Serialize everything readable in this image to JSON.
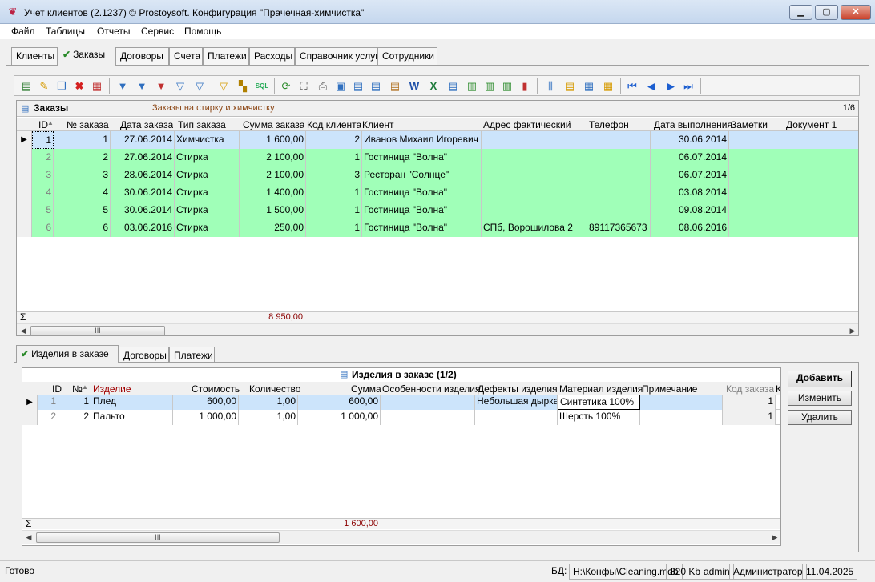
{
  "window": {
    "title": "Учет клиентов (2.1237) © Prostoysoft. Конфигурация \"Прачечная-химчистка\""
  },
  "menu": [
    "Файл",
    "Таблицы",
    "Отчеты",
    "Сервис",
    "Помощь"
  ],
  "main_tabs": [
    "Клиенты",
    "Заказы",
    "Договоры",
    "Счета",
    "Платежи",
    "Расходы",
    "Справочник услуг",
    "Сотрудники"
  ],
  "toolbar_icons": [
    "add-icon",
    "edit-icon",
    "copy-icon",
    "delete-icon",
    "delete-all-icon",
    "filter-icon",
    "filter-add-icon",
    "filter-remove-icon",
    "filter-clear-icon",
    "filter-settings-icon",
    "filter-saved-icon",
    "filter-tree-icon",
    "sql-icon",
    "refresh-icon",
    "find-icon",
    "print-icon",
    "preview-icon",
    "export-icon",
    "export2-icon",
    "export3-icon",
    "word-icon",
    "excel-icon",
    "export-xml-icon",
    "csv-icon",
    "csv2-icon",
    "csv3-icon",
    "chart-icon",
    "columns-icon",
    "fields-icon",
    "grid-icon",
    "grid2-icon",
    "first-icon",
    "prev-icon",
    "next-icon",
    "last-icon"
  ],
  "orders": {
    "title": "Заказы",
    "subtitle": "Заказы на стирку и химчистку",
    "counter": "1/6",
    "columns": [
      "ID",
      "№ заказа",
      "Дата заказа",
      "Тип заказа",
      "Сумма заказа",
      "Код клиента",
      "Клиент",
      "Адрес фактический",
      "Телефон",
      "Дата выполнения",
      "Заметки",
      "Документ 1"
    ],
    "rows": [
      [
        "1",
        "1",
        "27.06.2014",
        "Химчистка",
        "1 600,00",
        "2",
        "Иванов Михаил Игоревич",
        "",
        "",
        "30.06.2014",
        "",
        ""
      ],
      [
        "2",
        "2",
        "27.06.2014",
        "Стирка",
        "2 100,00",
        "1",
        "Гостиница \"Волна\"",
        "",
        "",
        "06.07.2014",
        "",
        ""
      ],
      [
        "3",
        "3",
        "28.06.2014",
        "Стирка",
        "2 100,00",
        "3",
        "Ресторан \"Солнце\"",
        "",
        "",
        "06.07.2014",
        "",
        ""
      ],
      [
        "4",
        "4",
        "30.06.2014",
        "Стирка",
        "1 400,00",
        "1",
        "Гостиница \"Волна\"",
        "",
        "",
        "03.08.2014",
        "",
        ""
      ],
      [
        "5",
        "5",
        "30.06.2014",
        "Стирка",
        "1 500,00",
        "1",
        "Гостиница \"Волна\"",
        "",
        "",
        "09.08.2014",
        "",
        ""
      ],
      [
        "6",
        "6",
        "03.06.2016",
        "Стирка",
        "250,00",
        "1",
        "Гостиница \"Волна\"",
        "СПб, Ворошилова 2",
        "89117365673",
        "08.06.2016",
        "",
        ""
      ]
    ],
    "sum_symbol": "Σ",
    "total": "8 950,00",
    "scroll_thumb": "III"
  },
  "sub_tabs": [
    "Изделия в заказе",
    "Договоры",
    "Платежи"
  ],
  "items": {
    "title": "Изделия в заказе (1/2)",
    "columns": [
      "ID",
      "№",
      "Изделие",
      "Стоимость",
      "Количество",
      "Сумма",
      "Особенности изделия",
      "Дефекты изделия",
      "Материал изделия",
      "Примечание",
      "Код заказа",
      "К"
    ],
    "rows": [
      [
        "1",
        "1",
        "Плед",
        "600,00",
        "1,00",
        "600,00",
        "",
        "Небольшая дырка",
        "Синтетика 100%",
        "",
        "1"
      ],
      [
        "2",
        "2",
        "Пальто",
        "1 000,00",
        "1,00",
        "1 000,00",
        "",
        "",
        "Шерсть 100%",
        "",
        "1"
      ]
    ],
    "sum_symbol": "Σ",
    "total": "1 600,00",
    "scroll_thumb": "III"
  },
  "side_buttons": {
    "add": "Добавить",
    "edit": "Изменить",
    "delete": "Удалить"
  },
  "status": {
    "ready": "Готово",
    "db_label": "БД:",
    "db_path": "H:\\Конфы\\Cleaning.mdb",
    "db_size": "820 Kb",
    "user": "admin",
    "role": "Администратор",
    "date": "11.04.2025"
  },
  "colors": {
    "green_row": "#a0ffb8",
    "selected_row": "#cce4fb",
    "total_text": "#8b0000",
    "subtitle": "#8b4513"
  }
}
